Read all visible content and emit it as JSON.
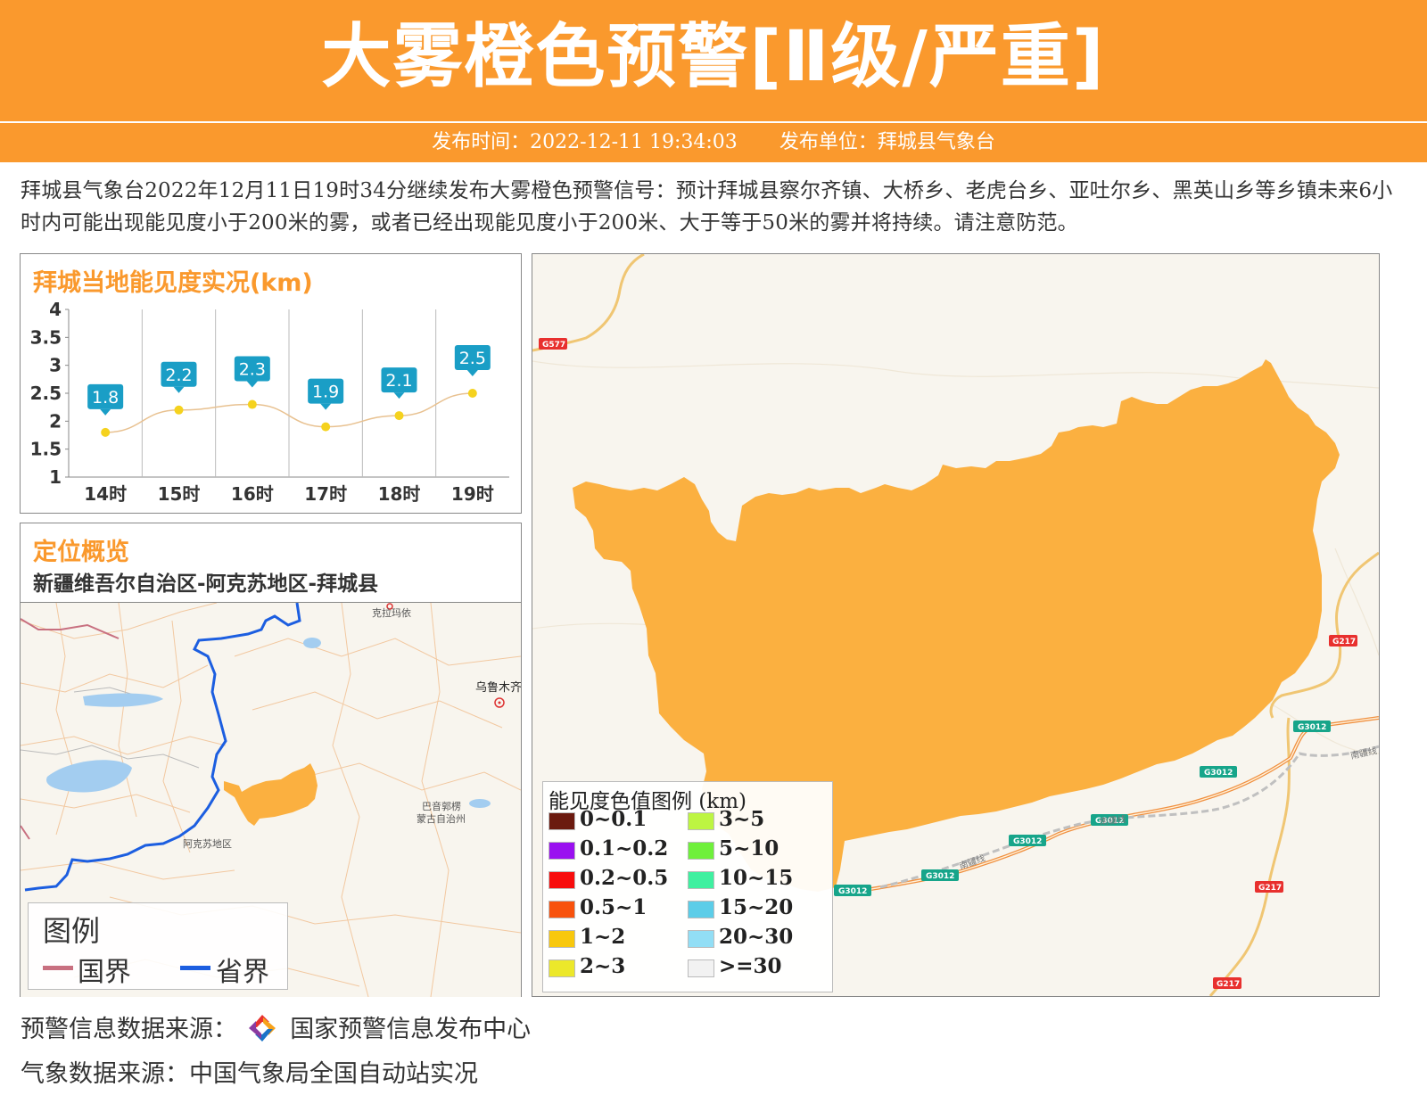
{
  "header": {
    "title": "大雾橙色预警[Ⅱ级/严重]",
    "publish_time": "发布时间：2022-12-11 19:34:03",
    "publish_unit": "发布单位：拜城县气象台",
    "colors": {
      "title_bg": "#fa992d",
      "text": "#ffffff"
    }
  },
  "description": "拜城县气象台2022年12月11日19时34分继续发布大雾橙色预警信号：预计拜城县察尔齐镇、大桥乡、老虎台乡、亚吐尔乡、黑英山乡等乡镇未来6小时内可能出现能见度小于200米的雾，或者已经出现能见度小于200米、大于等于50米的雾并将持续。请注意防范。",
  "visibility_panel": {
    "title": "拜城当地能见度实况(km)"
  },
  "chart_data": {
    "type": "line",
    "title": "拜城当地能见度实况(km)",
    "categories": [
      "14时",
      "15时",
      "16时",
      "17时",
      "18时",
      "19时"
    ],
    "values": [
      1.8,
      2.2,
      2.3,
      1.9,
      2.1,
      2.5
    ],
    "data_labels": [
      "1.8",
      "2.2",
      "2.3",
      "1.9",
      "2.1",
      "2.5"
    ],
    "yticks": [
      "1",
      "1.5",
      "2",
      "2.5",
      "3",
      "3.5",
      "4"
    ],
    "ylim": [
      1,
      4
    ],
    "line_color": "#e8c190",
    "point_color": "#f5d21e",
    "label_bg": "#1a9ec6"
  },
  "location_panel": {
    "title": "定位概览",
    "path": "新疆维吾尔自治区-阿克苏地区-拜城县",
    "map_labels": {
      "kelamayi": "克拉玛依",
      "urumqi": "乌鲁木齐",
      "bayingolin": "巴音郭楞\n蒙古自治州",
      "bayingolin_line1": "巴音郭楞",
      "bayingolin_line2": "蒙古自治州",
      "aksu": "阿克苏地区"
    },
    "legend": {
      "title": "图例",
      "national": "国界",
      "provincial": "省界",
      "national_color": "#c87080",
      "provincial_color": "#1c5ee0"
    }
  },
  "main_map": {
    "region_color": "#fbb040",
    "road_labels": [
      "G577",
      "G217",
      "G217",
      "G217",
      "G3012",
      "G3012",
      "G3012",
      "G3012",
      "G3012",
      "G3012"
    ],
    "rail_labels": [
      "南疆线",
      "南疆线",
      "南疆线"
    ],
    "legend": {
      "title": "能见度色值图例 (km)",
      "items": [
        {
          "label": "0~0.1",
          "color": "#6b1a0f"
        },
        {
          "label": "3~5",
          "color": "#bdf542"
        },
        {
          "label": "0.1~0.2",
          "color": "#9a10f0"
        },
        {
          "label": "5~10",
          "color": "#6ff03b"
        },
        {
          "label": "0.2~0.5",
          "color": "#f80d0d"
        },
        {
          "label": "10~15",
          "color": "#3ff0a0"
        },
        {
          "label": "0.5~1",
          "color": "#f8520d"
        },
        {
          "label": "15~20",
          "color": "#5ccde8"
        },
        {
          "label": "1~2",
          "color": "#f8c80d"
        },
        {
          "label": "20~30",
          "color": "#92def5"
        },
        {
          "label": "2~3",
          "color": "#ece82a"
        },
        {
          "label": ">=30",
          "color": "#f2f2f2"
        }
      ]
    }
  },
  "footer": {
    "warning_source": "预警信息数据来源：",
    "warning_source_org": "国家预警信息发布中心",
    "weather_source": "气象数据来源：中国气象局全国自动站实况"
  }
}
